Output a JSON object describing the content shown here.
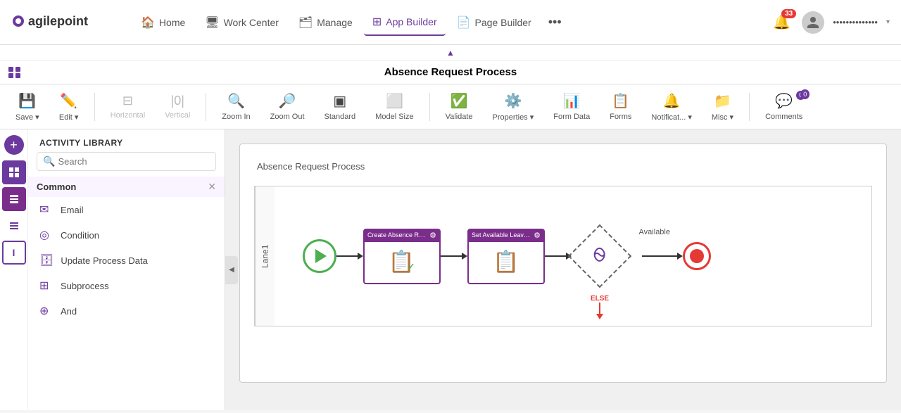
{
  "app": {
    "logo": "agilepoint"
  },
  "topnav": {
    "items": [
      {
        "label": "Home",
        "icon": "🏠",
        "id": "home",
        "active": false
      },
      {
        "label": "Work Center",
        "icon": "🖥",
        "id": "work-center",
        "active": false
      },
      {
        "label": "Manage",
        "icon": "🗂",
        "id": "manage",
        "active": false
      },
      {
        "label": "App Builder",
        "icon": "⊞",
        "id": "app-builder",
        "active": true
      },
      {
        "label": "Page Builder",
        "icon": "📄",
        "id": "page-builder",
        "active": false
      }
    ],
    "more_label": "•••",
    "notification_count": "33",
    "user_name": "••••••••••••••",
    "chevron": "▾"
  },
  "toolbar": {
    "collapse_arrow": "▲",
    "page_title": "Absence Request Process",
    "buttons": [
      {
        "id": "save",
        "label": "Save ▾",
        "icon": "💾",
        "disabled": false
      },
      {
        "id": "edit",
        "label": "Edit ▾",
        "icon": "✏️",
        "disabled": false
      },
      {
        "id": "horizontal",
        "label": "Horizontal",
        "icon": "⊟",
        "disabled": true
      },
      {
        "id": "vertical",
        "label": "Vertical",
        "icon": "|0|",
        "disabled": true
      },
      {
        "id": "zoom-in",
        "label": "Zoom In",
        "icon": "🔍+",
        "disabled": false
      },
      {
        "id": "zoom-out",
        "label": "Zoom Out",
        "icon": "🔍-",
        "disabled": false
      },
      {
        "id": "standard",
        "label": "Standard",
        "icon": "▣",
        "disabled": false
      },
      {
        "id": "model-size",
        "label": "Model Size",
        "icon": "⬜",
        "disabled": false
      },
      {
        "id": "validate",
        "label": "Validate",
        "icon": "✅",
        "disabled": false
      },
      {
        "id": "properties",
        "label": "Properties ▾",
        "icon": "⚙️",
        "disabled": false
      },
      {
        "id": "form-data",
        "label": "Form Data",
        "icon": "📊",
        "disabled": false
      },
      {
        "id": "forms",
        "label": "Forms",
        "icon": "📋",
        "disabled": false
      },
      {
        "id": "notifications",
        "label": "Notificat... ▾",
        "icon": "🔔",
        "disabled": false
      },
      {
        "id": "misc",
        "label": "Misc ▾",
        "icon": "📁",
        "disabled": false
      },
      {
        "id": "comments",
        "label": "Comments",
        "icon": "💬",
        "disabled": false,
        "badge": "0"
      }
    ]
  },
  "sidebar": {
    "activity_library_label": "ACTIVITY LIBRARY",
    "search_placeholder": "Search",
    "sections": [
      {
        "id": "common",
        "label": "Common",
        "expanded": true,
        "items": [
          {
            "id": "email",
            "label": "Email",
            "icon": "✉"
          },
          {
            "id": "condition",
            "label": "Condition",
            "icon": "◎"
          },
          {
            "id": "update-process-data",
            "label": "Update Process Data",
            "icon": "🗄"
          },
          {
            "id": "subprocess",
            "label": "Subprocess",
            "icon": "⊞"
          },
          {
            "id": "and",
            "label": "And",
            "icon": "⊕"
          }
        ]
      }
    ],
    "left_tabs": [
      {
        "id": "add",
        "icon": "+",
        "type": "fab"
      },
      {
        "id": "list",
        "icon": "≡",
        "active": true
      },
      {
        "id": "purple-block",
        "icon": "■",
        "color": "purple"
      },
      {
        "id": "text-lines",
        "icon": "≣",
        "color": "purple"
      },
      {
        "id": "bracket",
        "icon": "I",
        "color": "purple",
        "bordered": true
      }
    ]
  },
  "canvas": {
    "process_title": "Absence Request Process",
    "lane_label": "Lane1",
    "nodes": [
      {
        "id": "start",
        "type": "start-event"
      },
      {
        "id": "task1",
        "type": "task",
        "label": "Create Absence Reque...",
        "has_gear": true
      },
      {
        "id": "task2",
        "type": "task",
        "label": "Set Available Leave ...",
        "has_gear": true
      },
      {
        "id": "gateway",
        "type": "gateway",
        "available_label": "Available",
        "else_label": "ELSE"
      },
      {
        "id": "end",
        "type": "end-event"
      }
    ]
  },
  "colors": {
    "brand_purple": "#6c3a9e",
    "task_purple": "#7b2d8b",
    "start_green": "#4caf50",
    "end_red": "#e53935",
    "else_red": "#e53935"
  }
}
